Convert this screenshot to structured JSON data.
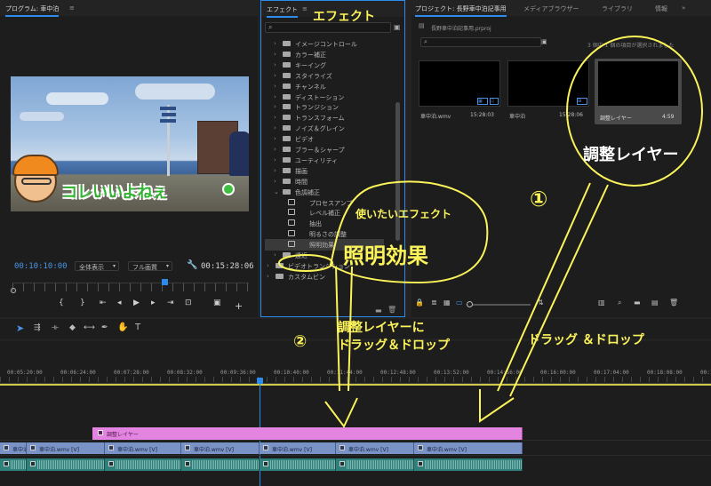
{
  "program": {
    "tab_label": "プログラム: 車中泊",
    "timecode_current": "00:10:10:00",
    "fit_select": "全体表示",
    "quality_select": "フル画質",
    "timecode_total": "00:15:28:06",
    "caption": "コレいいよねぇ"
  },
  "effects": {
    "tab_label": "エフェクト",
    "items": [
      {
        "label": "イメージコントロール",
        "level": 1,
        "open": false
      },
      {
        "label": "カラー補正",
        "level": 1,
        "open": false
      },
      {
        "label": "キーイング",
        "level": 1,
        "open": false
      },
      {
        "label": "スタイライズ",
        "level": 1,
        "open": false
      },
      {
        "label": "チャンネル",
        "level": 1,
        "open": false
      },
      {
        "label": "ディストーション",
        "level": 1,
        "open": false
      },
      {
        "label": "トランジション",
        "level": 1,
        "open": false
      },
      {
        "label": "トランスフォーム",
        "level": 1,
        "open": false
      },
      {
        "label": "ノイズ＆グレイン",
        "level": 1,
        "open": false
      },
      {
        "label": "ビデオ",
        "level": 1,
        "open": false
      },
      {
        "label": "ブラー＆シャープ",
        "level": 1,
        "open": false
      },
      {
        "label": "ユーティリティ",
        "level": 1,
        "open": false
      },
      {
        "label": "描画",
        "level": 1,
        "open": false
      },
      {
        "label": "時間",
        "level": 1,
        "open": false
      },
      {
        "label": "色調補正",
        "level": 1,
        "open": true
      },
      {
        "label": "プロセスアンプ",
        "level": 2,
        "open": false
      },
      {
        "label": "レベル補正",
        "level": 2,
        "open": false
      },
      {
        "label": "抽出",
        "level": 2,
        "open": false
      },
      {
        "label": "明るさの調整",
        "level": 2,
        "open": false
      },
      {
        "label": "照明効果",
        "level": 2,
        "open": false,
        "selected": true
      },
      {
        "label": "遠近",
        "level": 1,
        "open": false
      },
      {
        "label": "ビデオトランジション",
        "level": 0,
        "open": false
      },
      {
        "label": "カスタムビン",
        "level": 0,
        "open": false
      }
    ]
  },
  "project": {
    "tabs": [
      "プロジェクト: 長野車中泊記事用",
      "メディアブラウザー",
      "ライブラリ",
      "情報"
    ],
    "file_name": "長野車中泊記事用.prproj",
    "selection_info": "3 個中 1 個の項目が選択されました",
    "media": [
      {
        "name": "車中泊.wmv",
        "duration": "15:28:03"
      },
      {
        "name": "車中泊",
        "duration": "15:28:06"
      },
      {
        "name": "調整レイヤー",
        "duration": "4:59"
      }
    ]
  },
  "timeline": {
    "ruler": [
      "00:05:20:00",
      "00:06:24:00",
      "00:07:28:00",
      "00:08:32:00",
      "00:09:36:00",
      "00:10:40:00",
      "00:11:44:00",
      "00:12:48:00",
      "00:13:52:00",
      "00:14:56:00",
      "00:16:00:00",
      "00:17:04:00",
      "00:18:08:00",
      "00:19:"
    ],
    "adjustment_clip": "調整レイヤー",
    "video_clips": [
      "車中泊.wmv [V]",
      "車中泊.wmv [V]",
      "車中泊.wmv [V]",
      "車中泊.wmv [V]",
      "車中泊.wmv [V]",
      "車中泊.wmv [V]",
      "車中泊.wmv [V]"
    ]
  },
  "annotations": {
    "effects_heading": "エフェクト",
    "adjustment_layer": "調整レイヤー",
    "wanted_effect": "使いたいエフェクト",
    "lighting_effect": "照明効果",
    "step1": "①",
    "step2": "②",
    "drag_to_adjustment_line1": "調整レイヤーに",
    "drag_to_adjustment_line2": "ドラッグ＆ドロップ",
    "drag_drop": "ドラッグ ＆ドロップ"
  },
  "colors": {
    "accent": "#2d8ceb",
    "annotation": "#fbf35a",
    "adjustment_clip": "#e384e0",
    "video_clip": "#7a93c6",
    "audio_clip": "#2f7f7a"
  }
}
